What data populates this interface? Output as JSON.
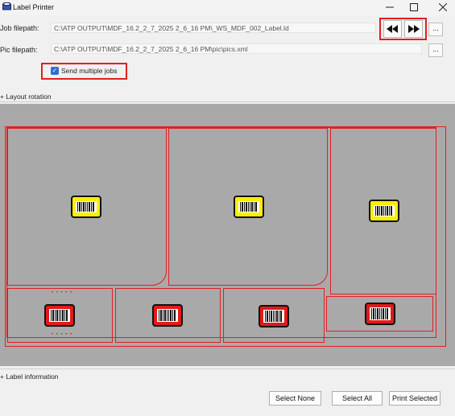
{
  "window": {
    "title": "Label Printer",
    "minimize_icon": "minimize-icon",
    "maximize_icon": "maximize-icon",
    "close_icon": "close-icon"
  },
  "job": {
    "label": "Job filepath:",
    "value": "C:\\ATP OUTPUT\\MDF_16.2_2_7_2025 2_6_16 PM\\_WS_MDF_002_Label.ld",
    "browse_label": "..."
  },
  "pic": {
    "label": "Pic filepath:",
    "value": "C:\\ATP OUTPUT\\MDF_16.2_2_7_2025 2_6_16 PM\\pic\\pics.xml",
    "browse_label": "..."
  },
  "nav": {
    "prev_icon": "rewind-icon",
    "next_icon": "fast-forward-icon"
  },
  "multiple_jobs": {
    "label": "Send multiple jobs",
    "checked": true
  },
  "sections": {
    "layout_rotation": "+ Layout rotation",
    "label_information": "+ Label information"
  },
  "dots": "• • • • •",
  "buttons": {
    "select_none": "Select None",
    "select_all": "Select All",
    "print_selected": "Print Selected"
  },
  "colors": {
    "accent_red": "#e02020",
    "label_yellow": "#ffee00",
    "label_red": "#e21a1a",
    "canvas_gray": "#a9a9a9"
  }
}
